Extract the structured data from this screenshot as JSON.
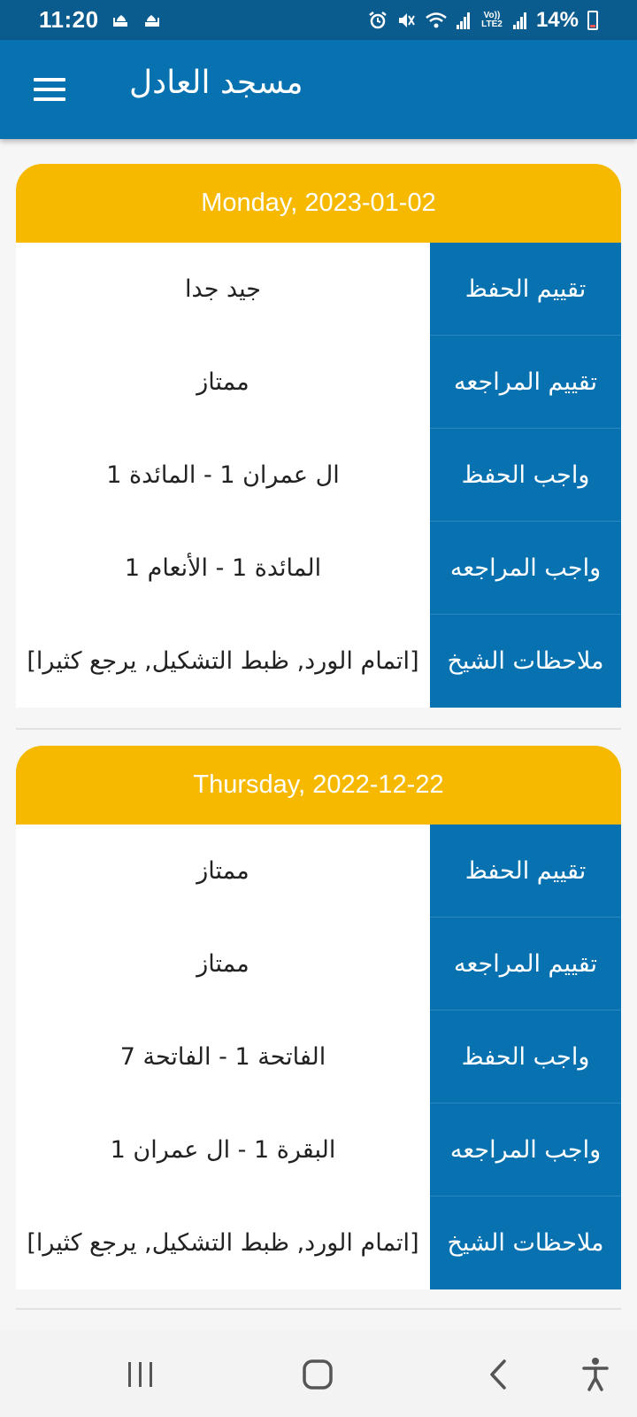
{
  "status_bar": {
    "time": "11:20",
    "battery": "14%",
    "volte": "Vo)) LTE2",
    "icons": [
      "mosque-icon",
      "mosque-icon",
      "alarm-icon",
      "mute-icon",
      "wifi-icon",
      "signal-icon",
      "signal-icon"
    ]
  },
  "app_bar": {
    "title": "مسجد العادل",
    "menu_icon": "hamburger-menu-icon"
  },
  "records": [
    {
      "date": "Monday, 2023-01-02",
      "rows": [
        {
          "label": "تقييم الحفظ",
          "value": "جيد جدا"
        },
        {
          "label": "تقييم المراجعه",
          "value": "ممتاز"
        },
        {
          "label": "واجب الحفظ",
          "value": "ال عمران 1 - المائدة 1"
        },
        {
          "label": "واجب المراجعه",
          "value": "المائدة 1 - الأنعام 1"
        },
        {
          "label": "ملاحظات الشيخ",
          "value": "[اتمام الورد, ظبط التشكيل, يرجع كثيرا]"
        }
      ]
    },
    {
      "date": "Thursday, 2022-12-22",
      "rows": [
        {
          "label": "تقييم الحفظ",
          "value": "ممتاز"
        },
        {
          "label": "تقييم المراجعه",
          "value": "ممتاز"
        },
        {
          "label": "واجب الحفظ",
          "value": "الفاتحة 1 - الفاتحة 7"
        },
        {
          "label": "واجب المراجعه",
          "value": "البقرة 1 - ال عمران 1"
        },
        {
          "label": "ملاحظات الشيخ",
          "value": "[اتمام الورد, ظبط التشكيل, يرجع كثيرا]"
        }
      ]
    }
  ],
  "nav_bar": {
    "icons": [
      "recent-apps-icon",
      "home-icon",
      "back-icon",
      "accessibility-icon"
    ]
  },
  "colors": {
    "status_bar": "#0a5c8e",
    "app_bar": "#0872b0",
    "card_header": "#f6b900",
    "label_cell": "#0872b0"
  }
}
